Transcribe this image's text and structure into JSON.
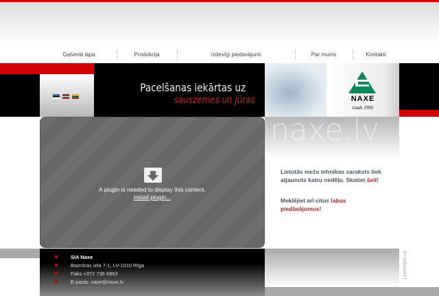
{
  "nav": [
    "Galvenā lapa",
    "Produkcija",
    "Izdevīgi piedavājumi",
    "Par mums",
    "Kontakti"
  ],
  "header": {
    "slogan_line1": "Pacelšanas iekārtas uz",
    "slogan_line2": "sauszemes un jūras",
    "logo_name": "NAXE",
    "logo_since": "Gads 1995",
    "flags": [
      "estonian-flag",
      "latvian-flag",
      "lithuanian-flag"
    ]
  },
  "plugin": {
    "message": "A plugin is needed to display this content.",
    "install_link": "Install plugin..."
  },
  "panel": {
    "brand": "naxe.lv",
    "p1_text": "Lietotās meža tehnikas saraksts tiek atjaunots katru nedēļu. Skatiet ",
    "p1_link": "šeit",
    "p1_end": "!",
    "p2_text": "Meklējiet arī citus ",
    "p2_link": "labus piedāvājumus",
    "p2_end": "!"
  },
  "footer": {
    "company": "SIA Naxe",
    "address": "Baznīcas iela 7-1, LV-1010 Rīga",
    "fax": "Faks +372 736 6863",
    "email": "E-pasts: naxe@naxe.lv",
    "credit": "BY HANSANET"
  },
  "colors": {
    "accent": "#d40000",
    "link": "#c81e1e"
  }
}
